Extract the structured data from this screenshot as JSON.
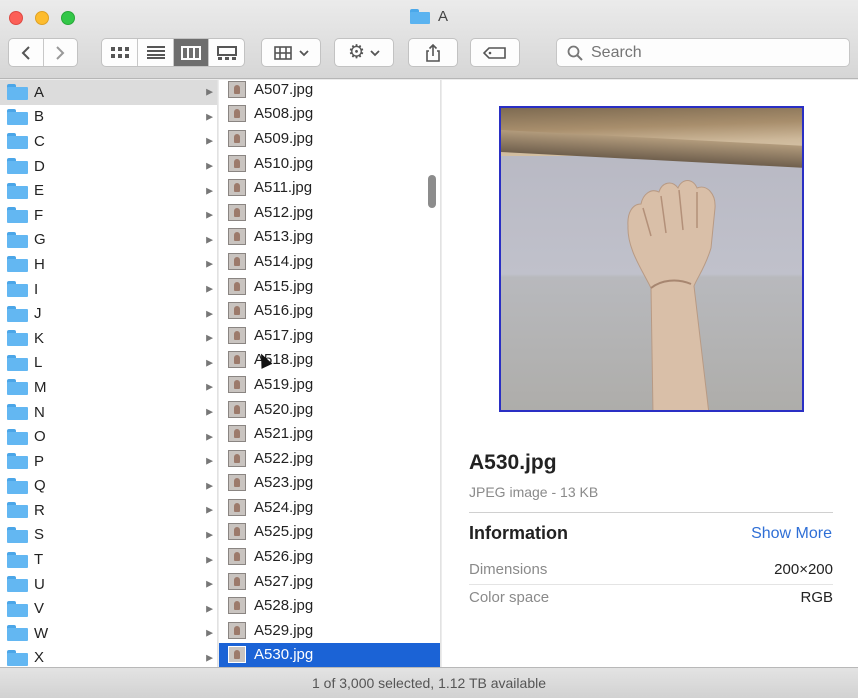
{
  "window": {
    "title": "A"
  },
  "toolbar": {
    "back_icon": "chevron-left-icon",
    "forward_icon": "chevron-right-icon",
    "view_modes": [
      "icon-view",
      "list-view",
      "column-view",
      "cover-flow-view"
    ],
    "active_view": "column-view",
    "search_placeholder": "Search"
  },
  "sidebar_folders": [
    "A",
    "B",
    "C",
    "D",
    "E",
    "F",
    "G",
    "H",
    "I",
    "J",
    "K",
    "L",
    "M",
    "N",
    "O",
    "P",
    "Q",
    "R",
    "S",
    "T",
    "U",
    "V",
    "W",
    "X"
  ],
  "selected_folder": "A",
  "files": [
    "A507.jpg",
    "A508.jpg",
    "A509.jpg",
    "A510.jpg",
    "A511.jpg",
    "A512.jpg",
    "A513.jpg",
    "A514.jpg",
    "A515.jpg",
    "A516.jpg",
    "A517.jpg",
    "A518.jpg",
    "A519.jpg",
    "A520.jpg",
    "A521.jpg",
    "A522.jpg",
    "A523.jpg",
    "A524.jpg",
    "A525.jpg",
    "A526.jpg",
    "A527.jpg",
    "A528.jpg",
    "A529.jpg",
    "A530.jpg"
  ],
  "selected_file": "A530.jpg",
  "preview": {
    "filename": "A530.jpg",
    "kind": "JPEG image - 13 KB",
    "info_title": "Information",
    "show_more": "Show More",
    "meta": [
      {
        "label": "Dimensions",
        "value": "200×200"
      },
      {
        "label": "Color space",
        "value": "RGB"
      }
    ]
  },
  "status": "1 of 3,000 selected, 1.12 TB available",
  "colors": {
    "selection": "#1b63d6",
    "folder": "#63b7f2",
    "link": "#2f6fd6"
  }
}
